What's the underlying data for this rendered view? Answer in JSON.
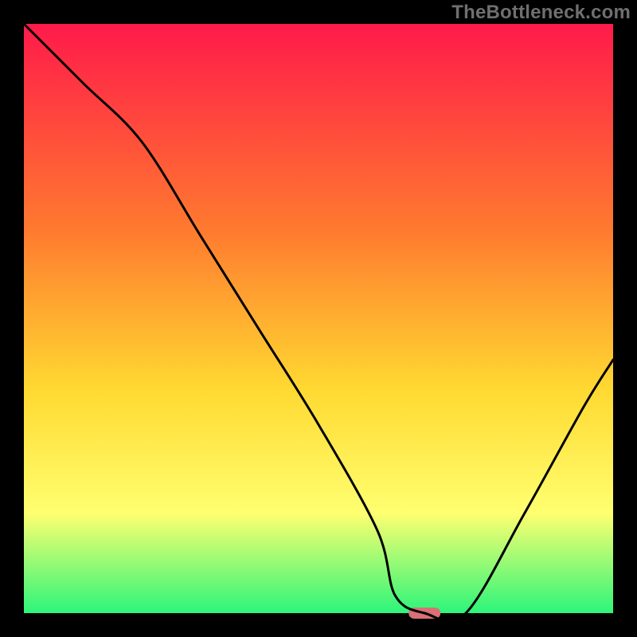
{
  "watermark": "TheBottleneck.com",
  "chart_data": {
    "type": "line",
    "title": "",
    "xlabel": "",
    "ylabel": "",
    "xlim": [
      0,
      100
    ],
    "ylim": [
      0,
      100
    ],
    "series": [
      {
        "name": "curve",
        "x": [
          0,
          10,
          20,
          30,
          40,
          50,
          60,
          63,
          68,
          75,
          85,
          95,
          100
        ],
        "values": [
          100,
          90,
          80,
          64,
          48,
          32,
          14,
          3,
          0,
          0,
          17,
          35,
          43
        ]
      }
    ],
    "marker": {
      "x": 68,
      "y": 0
    },
    "colors": {
      "background_top": "#ff1a4a",
      "background_mid1": "#ff7a2f",
      "background_mid2": "#ffd931",
      "background_mid3": "#ffff70",
      "background_bottom": "#2cf57a",
      "curve": "#000000",
      "marker": "#d87076",
      "frame": "#000000"
    }
  }
}
